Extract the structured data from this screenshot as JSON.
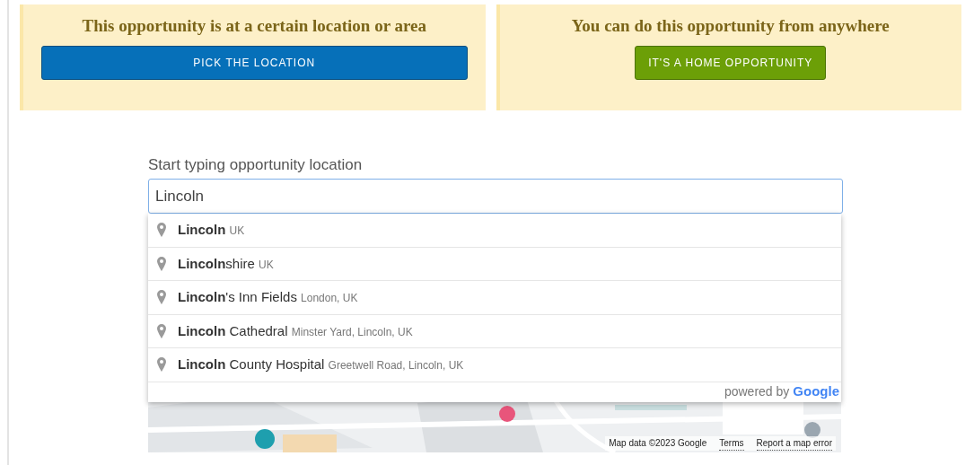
{
  "options": [
    {
      "heading": "This opportunity is at a certain location or area",
      "button": "PICK THE LOCATION",
      "kind": "wide"
    },
    {
      "heading": "You can do this opportunity from anywhere",
      "button": "IT'S A HOME OPPORTUNITY",
      "kind": "compact"
    }
  ],
  "location": {
    "label": "Start typing opportunity location",
    "value": "Lincoln"
  },
  "suggestions": [
    {
      "main": "**Lincoln**",
      "secondary": "UK"
    },
    {
      "main": "**Lincoln**shire",
      "secondary": "UK"
    },
    {
      "main": "**Lincoln**'s Inn Fields",
      "secondary": "London, UK"
    },
    {
      "main": "**Lincoln** Cathedral",
      "secondary": "Minster Yard, Lincoln, UK"
    },
    {
      "main": "**Lincoln** County Hospital",
      "secondary": "Greetwell Road, Lincoln, UK"
    }
  ],
  "attribution": {
    "prefix": "powered by",
    "brand": "Google"
  },
  "map": {
    "kind": "picture",
    "footer": [
      "Map data ©2023 Google",
      "Terms",
      "Report a map error"
    ]
  }
}
